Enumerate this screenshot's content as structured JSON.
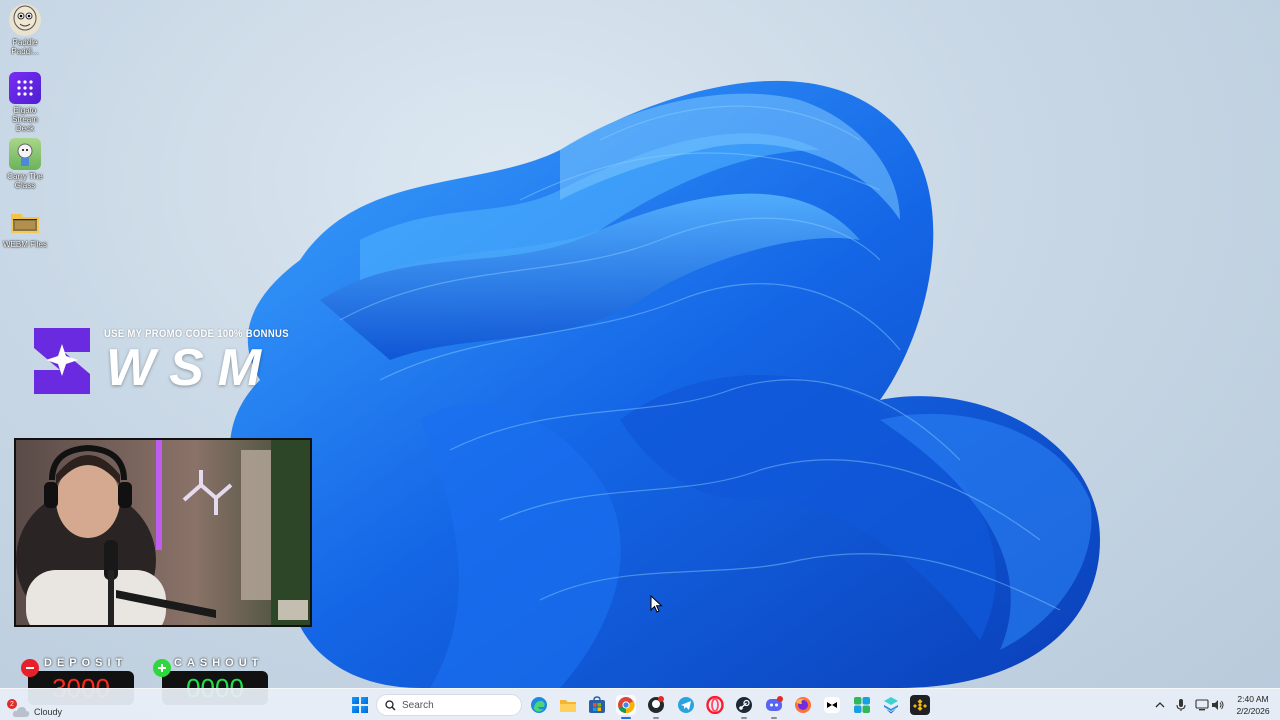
{
  "desktop": {
    "icons": [
      {
        "label": "Paddle Paddl...",
        "icon": "paddle-character-icon"
      },
      {
        "label": "Elgato Stream Deck",
        "icon": "stream-deck-icon"
      },
      {
        "label": "Carry The Glass",
        "icon": "carry-the-glass-icon"
      },
      {
        "label": "WEBM Files",
        "icon": "folder-icon"
      }
    ]
  },
  "promo": {
    "tagline": "USE MY PROMO CODE 100% BONNUS",
    "brand": "WSM",
    "color": "#6a2be0"
  },
  "overlay": {
    "deposit_label": "DEPOSIT",
    "deposit_value": "3000",
    "deposit_color": "#ff2a1a",
    "cashout_label": "CASHOUT",
    "cashout_value": "0000",
    "cashout_color": "#22e04a"
  },
  "taskbar": {
    "weather_text": "Cloudy",
    "weather_badge": "2",
    "search_placeholder": "Search",
    "apps": [
      "edge-icon",
      "file-explorer-icon",
      "microsoft-store-icon",
      "chrome-icon",
      "github-desktop-icon",
      "telegram-icon",
      "opera-icon",
      "steam-icon",
      "discord-icon",
      "firefox-icon",
      "capcut-icon",
      "photo-app-icon",
      "layers-app-icon",
      "binance-icon"
    ],
    "clock_time": "2:40 AM",
    "clock_date": "2/2/2026"
  }
}
